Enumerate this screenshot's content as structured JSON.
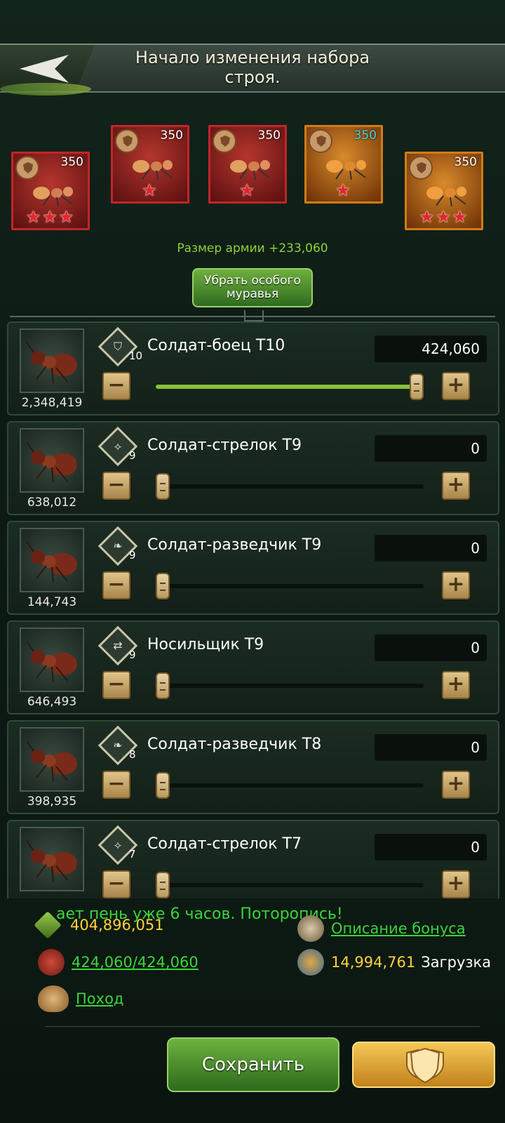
{
  "header": {
    "title": "Начало изменения набора строя.",
    "back_label": "back"
  },
  "special_ants": [
    {
      "level": "350",
      "stars": "★★★",
      "color": "red",
      "level_color": "white"
    },
    {
      "level": "350",
      "stars": "★",
      "color": "red",
      "level_color": "white"
    },
    {
      "level": "350",
      "stars": "★",
      "color": "red",
      "level_color": "white"
    },
    {
      "level": "350",
      "stars": "★",
      "color": "gold",
      "level_color": "cyan"
    },
    {
      "level": "350",
      "stars": "★★★",
      "color": "gold",
      "level_color": "white"
    }
  ],
  "army_size": "Размер армии +233,060",
  "remove_special_label": "Убрать особого муравья",
  "units": [
    {
      "count": "2,348,419",
      "type_level": "10",
      "name": "Солдат-боец T10",
      "qty": "424,060",
      "fill": 1.0,
      "type_icon": "shield-icon"
    },
    {
      "count": "638,012",
      "type_level": "9",
      "name": "Солдат-стрелок T9",
      "qty": "0",
      "fill": 0.0,
      "type_icon": "bow-icon"
    },
    {
      "count": "144,743",
      "type_level": "9",
      "name": "Солдат-разведчик T9",
      "qty": "0",
      "fill": 0.0,
      "type_icon": "wing-icon"
    },
    {
      "count": "646,493",
      "type_level": "9",
      "name": "Носильщик T9",
      "qty": "0",
      "fill": 0.0,
      "type_icon": "transfer-icon"
    },
    {
      "count": "398,935",
      "type_level": "8",
      "name": "Солдат-разведчик T8",
      "qty": "0",
      "fill": 0.0,
      "type_icon": "wing-icon"
    },
    {
      "count": "",
      "type_level": "7",
      "name": "Солдат-стрелок T7",
      "qty": "0",
      "fill": 0.0,
      "type_icon": "bow-icon"
    }
  ],
  "ticker": "ает пень уже 6 часов. Поторопись!",
  "stats": {
    "power": "404,896,051",
    "bonus_link": "Описание бонуса",
    "troops": "424,060/424,060",
    "load_value": "14,994,761",
    "load_label": "Загрузка",
    "march_link": "Поход"
  },
  "save_label": "Сохранить",
  "colors": {
    "accent_green": "#3bd43b",
    "army_green": "#8ed23a",
    "gold": "#ffd23a"
  }
}
